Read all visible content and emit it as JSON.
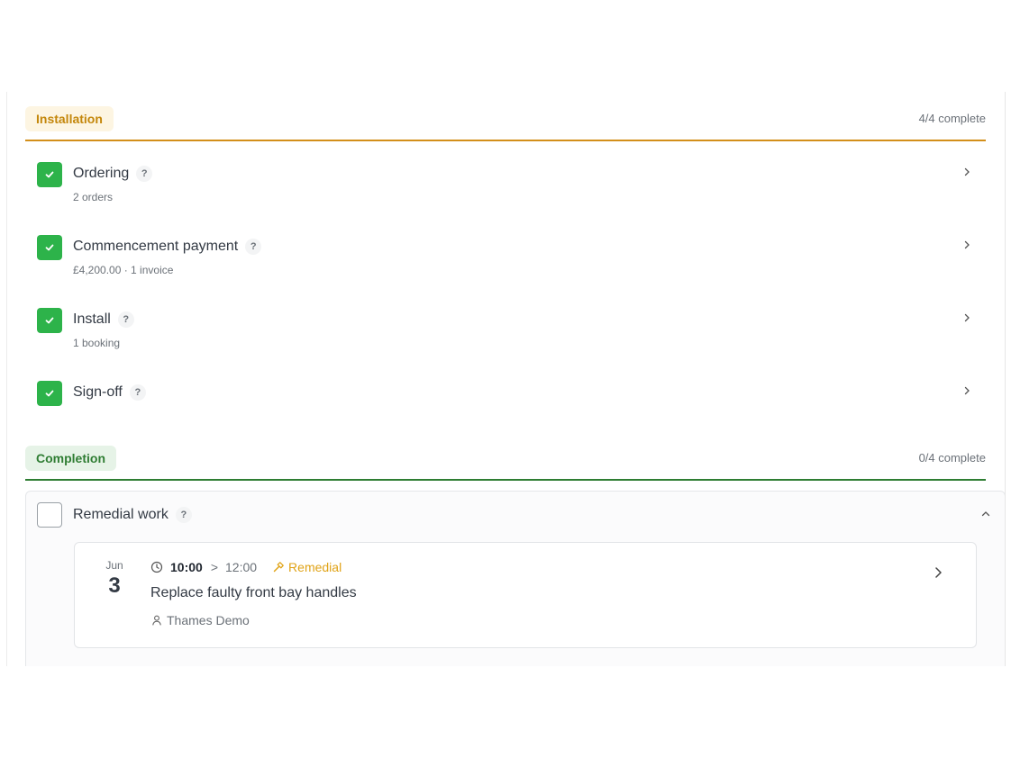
{
  "sections": [
    {
      "name": "Installation",
      "progress": "4/4 complete",
      "tasks": [
        {
          "title": "Ordering",
          "help": "?",
          "subtitle": "2 orders",
          "done": true
        },
        {
          "title": "Commencement payment",
          "help": "?",
          "subtitle": "£4,200.00 · 1 invoice",
          "done": true
        },
        {
          "title": "Install",
          "help": "?",
          "subtitle": "1 booking",
          "done": true
        },
        {
          "title": "Sign-off",
          "help": "?",
          "subtitle": "",
          "done": true
        }
      ]
    },
    {
      "name": "Completion",
      "progress": "0/4 complete",
      "tasks": [
        {
          "title": "Remedial work",
          "help": "?",
          "done": false,
          "expanded": true,
          "booking": {
            "month": "Jun",
            "day": "3",
            "start": "10:00",
            "separator": ">",
            "end": "12:00",
            "type": "Remedial",
            "title": "Replace faulty front bay handles",
            "assignee": "Thames Demo"
          }
        }
      ]
    }
  ],
  "colors": {
    "installation_accent": "#d38f1a",
    "completion_accent": "#2e7d32",
    "check_green": "#2db34a",
    "remedial_amber": "#e0a317"
  },
  "icons": {
    "check": "check-icon",
    "help": "help-icon",
    "chevron_right": "chevron-right-icon",
    "chevron_up": "chevron-up-icon",
    "clock": "clock-icon",
    "hammer": "hammer-icon",
    "user": "user-icon"
  }
}
